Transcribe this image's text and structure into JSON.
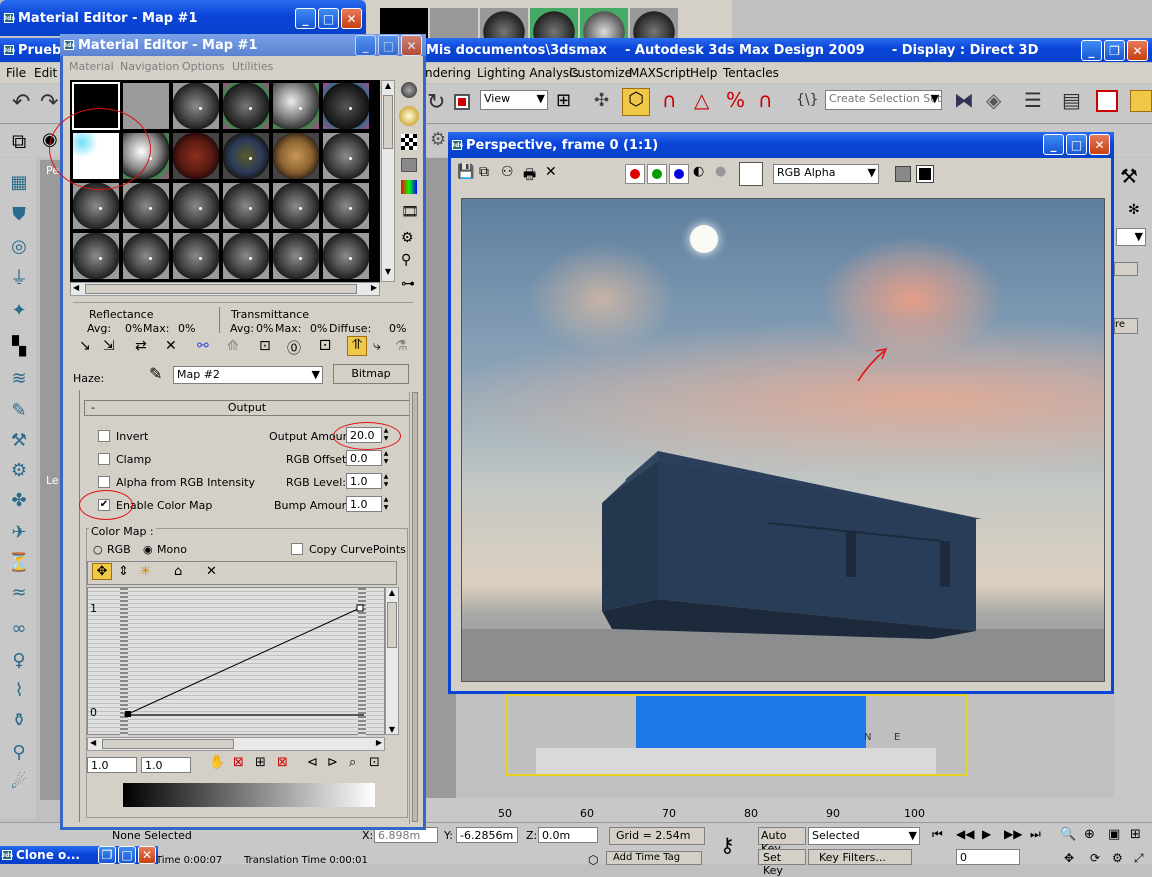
{
  "top_window": {
    "title": "Material Editor - Map #1"
  },
  "main_window": {
    "title_left": "Prueb",
    "title_right": "Mis documentos\\3dsmax    - Autodesk 3ds Max Design 2009      - Display : Direct 3D"
  },
  "main_menu": [
    "File",
    "Edit",
    "ndering",
    "Lighting Analysis",
    "Customize",
    "MAXScript",
    "Help",
    "Tentacles"
  ],
  "toolbar": {
    "view_select": "View",
    "selection_set": "Create Selection Set"
  },
  "material_editor": {
    "title": "Material Editor - Map #1",
    "menu": [
      "Material",
      "Navigation",
      "Options",
      "Utilities"
    ],
    "reflectance": {
      "header": "Reflectance",
      "avg_label": "Avg:",
      "avg": "0%",
      "max_label": "Max:",
      "max": "0%"
    },
    "transmittance": {
      "header": "Transmittance",
      "avg_label": "Avg:",
      "avg": "0%",
      "max_label": "Max:",
      "max": "0%",
      "diffuse_label": "Diffuse:",
      "diffuse": "0%"
    },
    "haze": {
      "label": "Haze:",
      "map_name": "Map #2",
      "type_button": "Bitmap"
    },
    "output_rollout": {
      "sign": "-",
      "title": "Output"
    },
    "checkboxes": [
      {
        "label": "Invert",
        "checked": false
      },
      {
        "label": "Clamp",
        "checked": false
      },
      {
        "label": "Alpha from RGB Intensity",
        "checked": false
      },
      {
        "label": "Enable Color Map",
        "checked": true
      }
    ],
    "params": [
      {
        "label": "Output Amount:",
        "value": "20.0"
      },
      {
        "label": "RGB Offset:",
        "value": "0.0"
      },
      {
        "label": "RGB Level:",
        "value": "1.0"
      },
      {
        "label": "Bump Amount:",
        "value": "1.0"
      }
    ],
    "color_map": {
      "label": "Color Map :",
      "rgb": "RGB",
      "mono": "Mono",
      "mono_selected": true,
      "copy_curve_points": "Copy CurvePoints",
      "axis_top": "1",
      "axis_bottom": "0",
      "field1": "1.0",
      "field2": "1.0"
    }
  },
  "frame_window": {
    "title": "Perspective, frame 0 (1:1)",
    "channel_select": "RGB Alpha",
    "channel_colors": [
      "#e00000",
      "#00a000",
      "#0000e0"
    ]
  },
  "status": {
    "selection": "None Selected",
    "x_label": "X:",
    "x": "6.898m",
    "y_label": "Y:",
    "y": "-6.2856m",
    "z_label": "Z:",
    "z": "0.0m",
    "grid": "Grid = 2.54m",
    "auto_key": "Auto Key",
    "set_key": "Set Key",
    "key_mode": "Selected",
    "key_filters": "Key Filters...",
    "frame": "0",
    "add_time_tag": "Add Time Tag",
    "time_text": "Time  0:00:07",
    "translation_text": "Translation Time  0:00:01"
  },
  "timeline": {
    "ticks": [
      "50",
      "60",
      "70",
      "80",
      "90",
      "100"
    ]
  },
  "taskbar": {
    "item": "Clone o..."
  },
  "left_viewport": {
    "label_pe": "Pe",
    "label_le": "Le"
  }
}
